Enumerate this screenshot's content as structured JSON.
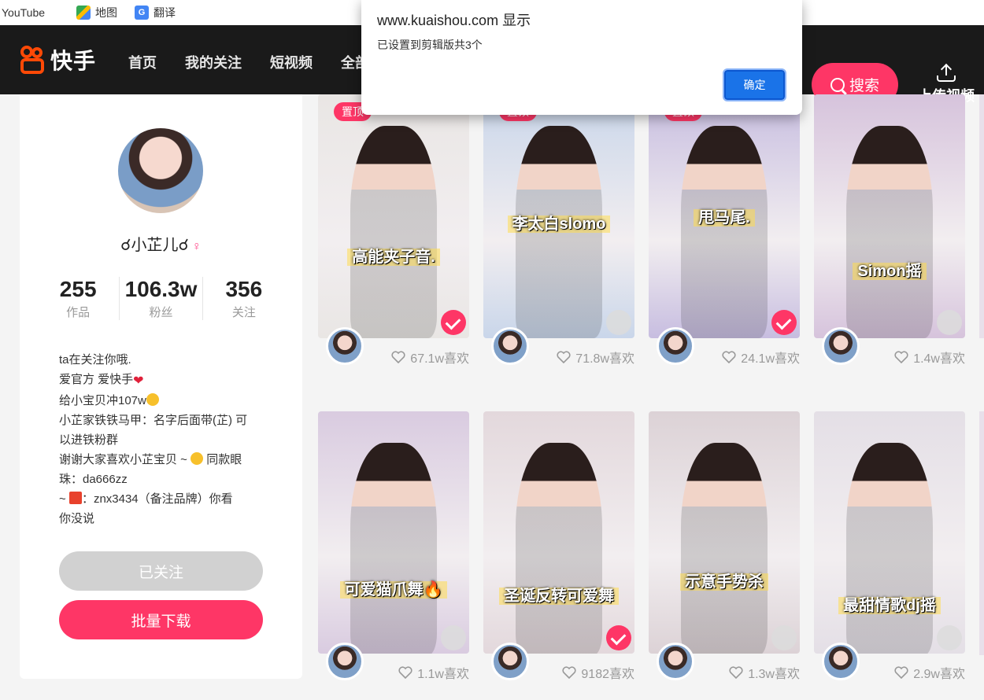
{
  "bookmarks": [
    {
      "label": "YouTube",
      "icon": "youtube-icon"
    },
    {
      "label": "地图",
      "icon": "maps-icon"
    },
    {
      "label": "翻译",
      "icon": "translate-icon"
    }
  ],
  "header": {
    "logo_text": "快手",
    "nav": [
      "首页",
      "我的关注",
      "短视频",
      "全部"
    ],
    "search_label": "搜索",
    "upload_label": "上传视频"
  },
  "profile": {
    "name": "☌小芷儿☌",
    "gender": "female",
    "stats": [
      {
        "value": "255",
        "label": "作品"
      },
      {
        "value": "106.3w",
        "label": "粉丝"
      },
      {
        "value": "356",
        "label": "关注"
      }
    ],
    "bio": {
      "line1": "ta在关注你哦.",
      "line2": "爱官方 爱快手",
      "line3": "给小宝贝冲107w",
      "line4": "小芷家铁铁马甲：名字后面带(芷) 可",
      "line5": "以进铁粉群",
      "line6a": "谢谢大家喜欢小芷宝贝 ~",
      "line6b": "同款眼",
      "line7": "珠：da666zz",
      "line8a": "~",
      "line8b": "：znx3434（备注品牌）你看",
      "line9": "你没说"
    },
    "followed_label": "已关注",
    "download_label": "批量下载"
  },
  "videos": [
    {
      "caption": "高能夹子音.",
      "likes": "67.1w喜欢",
      "pinned": true,
      "pin_label": "置顶",
      "selected": true,
      "bg": "#e9e6e4"
    },
    {
      "caption": "李太白slomo",
      "likes": "71.8w喜欢",
      "pinned": true,
      "pin_label": "置顶",
      "selected": false,
      "bg": "#c9d6ea"
    },
    {
      "caption": "甩马尾.",
      "likes": "24.1w喜欢",
      "pinned": true,
      "pin_label": "置顶",
      "selected": true,
      "bg": "#c7bde0"
    },
    {
      "caption": "Simon摇",
      "likes": "1.4w喜欢",
      "pinned": false,
      "pin_label": "",
      "selected": false,
      "bg": "#d6c3dc"
    },
    {
      "caption": "可爱猫爪舞🔥",
      "likes": "1.1w喜欢",
      "pinned": false,
      "pin_label": "",
      "selected": false,
      "bg": "#d9cbe0"
    },
    {
      "caption": "圣诞反转可爱舞",
      "likes": "9182喜欢",
      "pinned": false,
      "pin_label": "",
      "selected": true,
      "bg": "#e3d8dc"
    },
    {
      "caption": "示意手势杀",
      "likes": "1.3w喜欢",
      "pinned": false,
      "pin_label": "",
      "selected": false,
      "bg": "#dcd2d6"
    },
    {
      "caption": "最甜情歌dj摇",
      "likes": "2.9w喜欢",
      "pinned": false,
      "pin_label": "",
      "selected": false,
      "bg": "#e4dfe6"
    }
  ],
  "dialog": {
    "title": "www.kuaishou.com 显示",
    "message": "已设置到剪辑版共3个",
    "ok_label": "确定"
  },
  "colors": {
    "accent": "#fe3666",
    "header_bg": "#1a1a1a",
    "dialog_button": "#1a73e8"
  }
}
